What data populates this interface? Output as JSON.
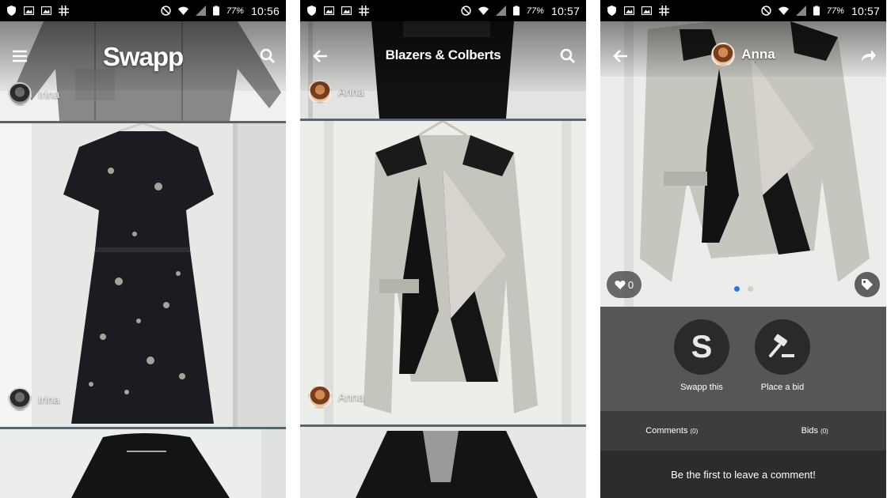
{
  "status_bar": {
    "battery": [
      "77%",
      "77%",
      "77%"
    ],
    "time": [
      "10:56",
      "10:57",
      "10:57"
    ]
  },
  "screen1": {
    "app_title": "Swapp",
    "sellers": [
      "Irina",
      "Irina"
    ]
  },
  "screen2": {
    "category_title": "Blazers & Colberts",
    "sellers": [
      "Anna",
      "Anna"
    ]
  },
  "screen3": {
    "seller": "Anna",
    "likes": "0",
    "swapp_label": "Swapp this",
    "bid_label": "Place a bid",
    "comments_label": "Comments",
    "comments_count": "(0)",
    "bids_label": "Bids",
    "bids_count": "(0)",
    "empty_comment_prompt": "Be the first to leave a comment!"
  },
  "icons": [
    "shield-icon",
    "image-icon",
    "hash-icon",
    "dnd-icon",
    "wifi-icon",
    "signal-icon",
    "battery-icon",
    "menu-icon",
    "search-icon",
    "back-arrow-icon",
    "share-icon",
    "heart-icon",
    "tag-icon",
    "gavel-icon"
  ]
}
